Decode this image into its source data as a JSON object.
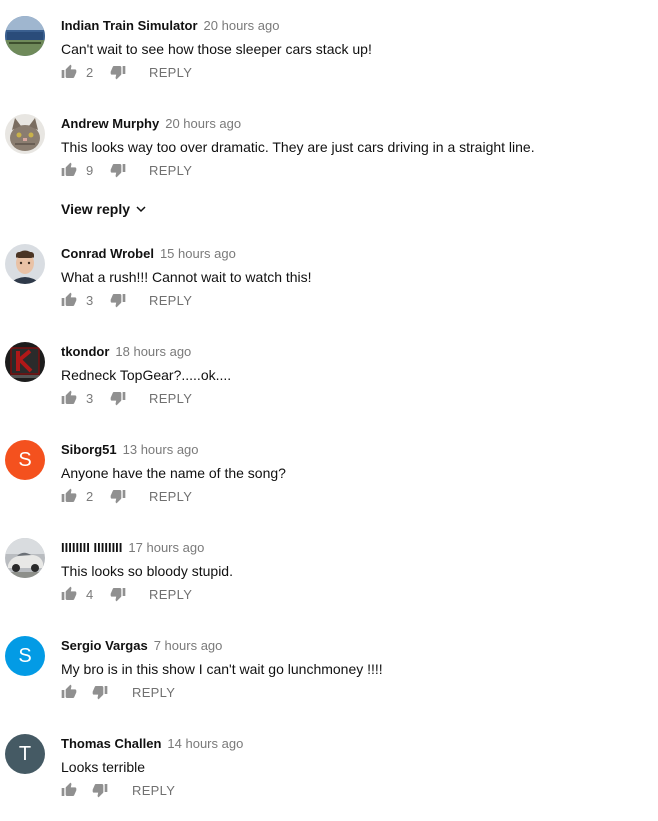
{
  "comments": [
    {
      "author": "Indian Train Simulator",
      "time": "20 hours ago",
      "text": "Can't wait to see how those sleeper cars stack up!",
      "likes": "2",
      "reply": "REPLY",
      "avatar": {
        "type": "image",
        "desc": "train-photo"
      }
    },
    {
      "author": "Andrew Murphy",
      "time": "20 hours ago",
      "text": "This looks way too over dramatic. They are just cars driving in a straight line.",
      "likes": "9",
      "reply": "REPLY",
      "avatar": {
        "type": "image",
        "desc": "cat-photo"
      }
    },
    {
      "author": "Conrad Wrobel",
      "time": "15 hours ago",
      "text": "What a rush!!! Cannot wait to watch this!",
      "likes": "3",
      "reply": "REPLY",
      "avatar": {
        "type": "image",
        "desc": "man-portrait"
      }
    },
    {
      "author": "tkondor",
      "time": "18 hours ago",
      "text": "Redneck TopGear?.....ok....",
      "likes": "3",
      "reply": "REPLY",
      "avatar": {
        "type": "image",
        "desc": "k-logo"
      }
    },
    {
      "author": "Siborg51",
      "time": "13 hours ago",
      "text": "Anyone have the name of the song?",
      "likes": "2",
      "reply": "REPLY",
      "avatar": {
        "type": "letter",
        "letter": "S",
        "color": "#f4511e"
      }
    },
    {
      "author": "IIIIIIII IIIIIIII",
      "time": "17 hours ago",
      "text": "This looks so bloody stupid.",
      "likes": "4",
      "reply": "REPLY",
      "avatar": {
        "type": "image",
        "desc": "car-photo"
      }
    },
    {
      "author": "Sergio Vargas",
      "time": "7 hours ago",
      "text": "My bro is in this show I can't wait go lunchmoney !!!!",
      "likes": "",
      "reply": "REPLY",
      "avatar": {
        "type": "letter",
        "letter": "S",
        "color": "#039be5"
      }
    },
    {
      "author": "Thomas Challen",
      "time": "14 hours ago",
      "text": "Looks terrible",
      "likes": "",
      "reply": "REPLY",
      "avatar": {
        "type": "letter",
        "letter": "T",
        "color": "#455a64"
      }
    }
  ],
  "view_reply_label": "View reply",
  "colors": {
    "icon": "#909090",
    "text": "#111111",
    "meta": "#7a7a7a"
  }
}
